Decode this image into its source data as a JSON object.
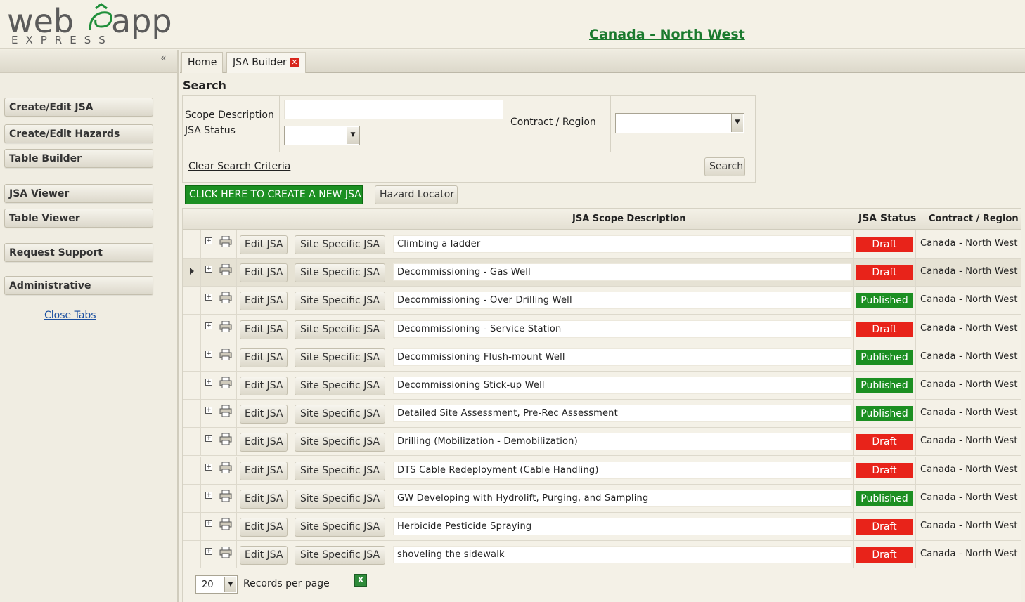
{
  "app": {
    "logo_main": "web app",
    "logo_sub": "EXPRESS",
    "region_title": "Canada - North West"
  },
  "sidebar": {
    "collapse_label": "«",
    "items": [
      {
        "label": "Create/Edit JSA"
      },
      {
        "label": "Create/Edit Hazards"
      },
      {
        "label": "Table Builder"
      },
      {
        "label": "JSA Viewer"
      },
      {
        "label": "Table Viewer"
      },
      {
        "label": "Request Support"
      },
      {
        "label": "Administrative"
      }
    ],
    "close_tabs": "Close Tabs"
  },
  "tabs": [
    {
      "label": "Home"
    },
    {
      "label": "JSA Builder",
      "close": "✕"
    }
  ],
  "search": {
    "title": "Search",
    "scope_label": "Scope Description",
    "scope_value": "",
    "status_label": "JSA Status",
    "status_value": "",
    "region_label": "Contract / Region",
    "region_value": "",
    "clear_label": "Clear Search Criteria",
    "search_button": "Search"
  },
  "actions": {
    "create_new": "CLICK HERE TO CREATE A NEW JSA",
    "hazard_locator": "Hazard Locator"
  },
  "grid": {
    "columns": {
      "description": "JSA Scope Description",
      "status": "JSA Status",
      "region": "Contract / Region"
    },
    "edit_label": "Edit JSA",
    "site_label": "Site Specific JSA",
    "expand_symbol": "+",
    "rows": [
      {
        "description": "Climbing a ladder",
        "status": "Draft",
        "region": "Canada - North West"
      },
      {
        "description": "Decommissioning - Gas Well",
        "status": "Draft",
        "region": "Canada - North West",
        "selected": true
      },
      {
        "description": "Decommissioning - Over Drilling Well",
        "status": "Published",
        "region": "Canada - North West"
      },
      {
        "description": "Decommissioning - Service Station",
        "status": "Draft",
        "region": "Canada - North West"
      },
      {
        "description": "Decommissioning Flush-mount Well",
        "status": "Published",
        "region": "Canada - North West"
      },
      {
        "description": "Decommissioning Stick-up Well",
        "status": "Published",
        "region": "Canada - North West"
      },
      {
        "description": "Detailed Site Assessment, Pre-Rec Assessment",
        "status": "Published",
        "region": "Canada - North West"
      },
      {
        "description": "Drilling (Mobilization - Demobilization)",
        "status": "Draft",
        "region": "Canada - North West"
      },
      {
        "description": "DTS Cable Redeployment (Cable Handling)",
        "status": "Draft",
        "region": "Canada - North West"
      },
      {
        "description": "GW Developing with Hydrolift, Purging, and Sampling",
        "status": "Published",
        "region": "Canada - North West"
      },
      {
        "description": "Herbicide Pesticide Spraying",
        "status": "Draft",
        "region": "Canada - North West"
      },
      {
        "description": "shoveling the sidewalk",
        "status": "Draft",
        "region": "Canada - North West"
      }
    ],
    "page_size": "20",
    "records_label": "Records per page",
    "excel_symbol": "X"
  },
  "colors": {
    "draft": "#e8231a",
    "published": "#1c8f22",
    "region_title": "#1b7a2e"
  },
  "icons": [
    "expand-icon",
    "print-icon",
    "excel-icon",
    "close-icon",
    "dropdown-arrow-icon",
    "row-pointer-icon"
  ]
}
